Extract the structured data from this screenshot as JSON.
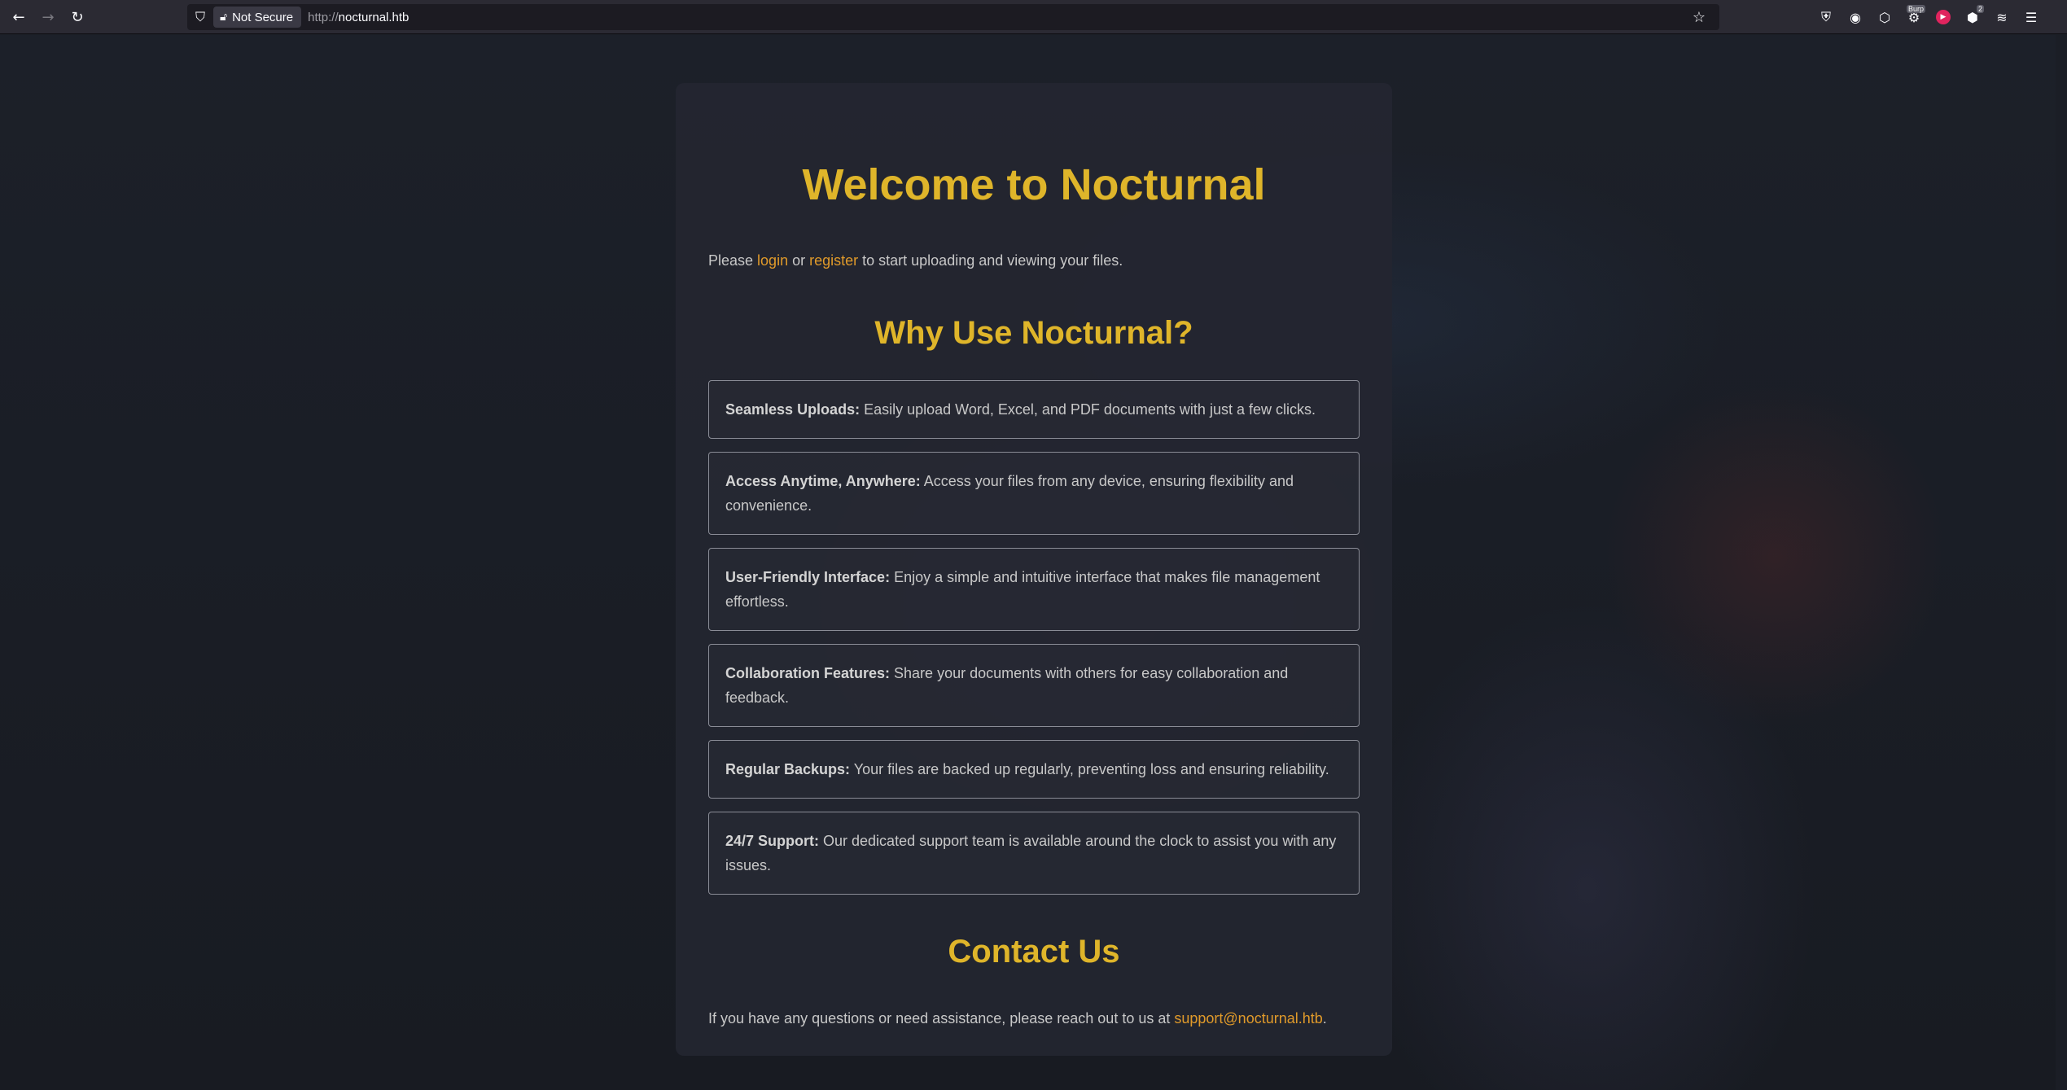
{
  "browser": {
    "url_protocol": "http://",
    "url_host": "nocturnal.htb",
    "security_label": "Not Secure",
    "extension_badges": {
      "burp": "Burp",
      "notes": "2"
    }
  },
  "page": {
    "title": "Welcome to Nocturnal",
    "intro": {
      "before": "Please ",
      "login": "login",
      "middle": " or ",
      "register": "register",
      "after": " to start uploading and viewing your files."
    },
    "why_heading": "Why Use Nocturnal?",
    "features": [
      {
        "title": "Seamless Uploads:",
        "text": " Easily upload Word, Excel, and PDF documents with just a few clicks."
      },
      {
        "title": "Access Anytime, Anywhere:",
        "text": " Access your files from any device, ensuring flexibility and convenience."
      },
      {
        "title": "User-Friendly Interface:",
        "text": " Enjoy a simple and intuitive interface that makes file management effortless."
      },
      {
        "title": "Collaboration Features:",
        "text": " Share your documents with others for easy collaboration and feedback."
      },
      {
        "title": "Regular Backups:",
        "text": " Your files are backed up regularly, preventing loss and ensuring reliability."
      },
      {
        "title": "24/7 Support:",
        "text": " Our dedicated support team is available around the clock to assist you with any issues."
      }
    ],
    "contact_heading": "Contact Us",
    "contact": {
      "before": "If you have any questions or need assistance, please reach out to us at ",
      "email": "support@nocturnal.htb",
      "after": "."
    }
  },
  "colors": {
    "accent": "#dfb52a",
    "link": "#e09a2a",
    "card_bg": "#242630",
    "page_bg": "#1b1e26"
  }
}
